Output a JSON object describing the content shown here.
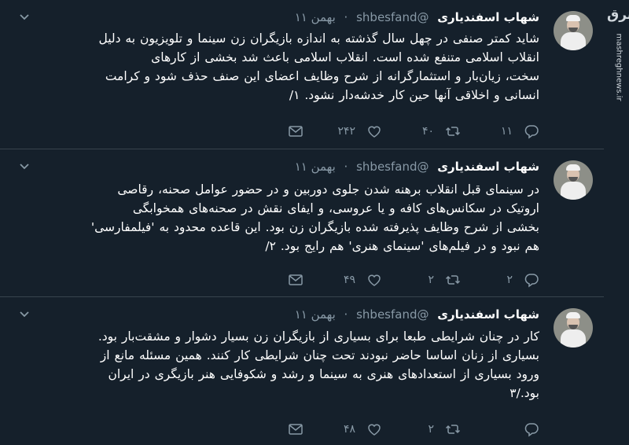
{
  "tweets": [
    {
      "name": "شهاب اسفندیاری",
      "handle": "@shbesfand",
      "dot": "·",
      "date": "بهمن ۱۱",
      "lines": [
        "شاید کمتر صنفی در چهل سال گذشته به اندازه بازیگران زن سینما و تلویزیون به دلیل",
        "انقلاب اسلامی متنفع شده است. انقلاب اسلامی باعث شد بخشی از کارهای",
        "سخت، زیان‌بار و استثمارگرانه از شرح وظایف اعضای این صنف حذف شود و کرامت",
        "انسانی و اخلاقی آنها حین کار خدشه‌دار نشود. ۱/"
      ],
      "reply_count": "۱۱",
      "retweet_count": "۴۰",
      "like_count": "۲۴۲"
    },
    {
      "name": "شهاب اسفندیاری",
      "handle": "@shbesfand",
      "dot": "·",
      "date": "بهمن ۱۱",
      "lines": [
        "در سینمای قبل انقلاب برهنه شدن جلوی دوربین و در حضور عوامل صحنه، رقاصی",
        "اروتیک در سکانس‌های کافه و یا عروسی، و ایفای نقش در صحنه‌های همخوابگی",
        "بخشی از شرح وظایف پذیرفته شده بازیگران زن بود. این قاعده محدود به 'فیلمفارسی'",
        "هم نبود و در فیلم‌های 'سینمای هنری' هم رایج بود. ۲/"
      ],
      "reply_count": "۲",
      "retweet_count": "۲",
      "like_count": "۴۹"
    },
    {
      "name": "شهاب اسفندیاری",
      "handle": "@shbesfand",
      "dot": "·",
      "date": "بهمن ۱۱",
      "lines": [
        "کار در چنان شرایطی طبعا برای بسیاری از بازیگران زن بسیار دشوار و مشقت‌بار بود.",
        "بسیاری از زنان اساسا حاضر نبودند تحت چنان شرایطی کار کنند. همین مسئله مانع از",
        "ورود بسیاری از استعدادهای هنری به سینما و رشد و شکوفایی هنر بازیگری در ایران",
        "بود./۳"
      ],
      "reply_count": "",
      "retweet_count": "۲",
      "like_count": "۴۸"
    }
  ],
  "watermark": {
    "logo": "مشرق",
    "url": "mashreghnews.ir"
  },
  "colors": {
    "background": "#15202b",
    "text": "#ffffff",
    "muted": "#8899a6",
    "divider": "#38444d"
  }
}
